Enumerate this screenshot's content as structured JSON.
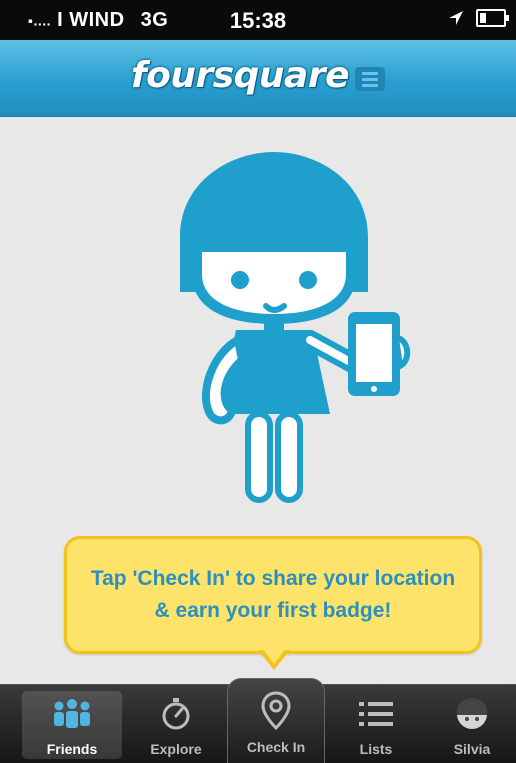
{
  "status_bar": {
    "carrier_dots": "▪....",
    "carrier": "I WIND",
    "network": "3G",
    "time": "15:38",
    "location_icon": "location-arrow-icon",
    "battery_icon": "battery-icon"
  },
  "nav_bar": {
    "logo": "foursquare",
    "menu_icon": "menu-icon"
  },
  "tooltip": {
    "text": "Tap 'Check In' to share your location & earn your first badge!"
  },
  "tabs": [
    {
      "label": "Friends",
      "icon": "friends-icon",
      "active": true
    },
    {
      "label": "Explore",
      "icon": "compass-icon",
      "active": false
    },
    {
      "label": "Check In",
      "icon": "map-pin-icon",
      "active": false
    },
    {
      "label": "Lists",
      "icon": "list-icon",
      "active": false
    },
    {
      "label": "Silvia",
      "icon": "avatar-icon",
      "active": false
    }
  ],
  "colors": {
    "brand_blue": "#2a9fcf",
    "character_blue": "#1fa0cc",
    "tooltip_yellow": "#fde36a",
    "tooltip_text": "#2b8fbf"
  }
}
